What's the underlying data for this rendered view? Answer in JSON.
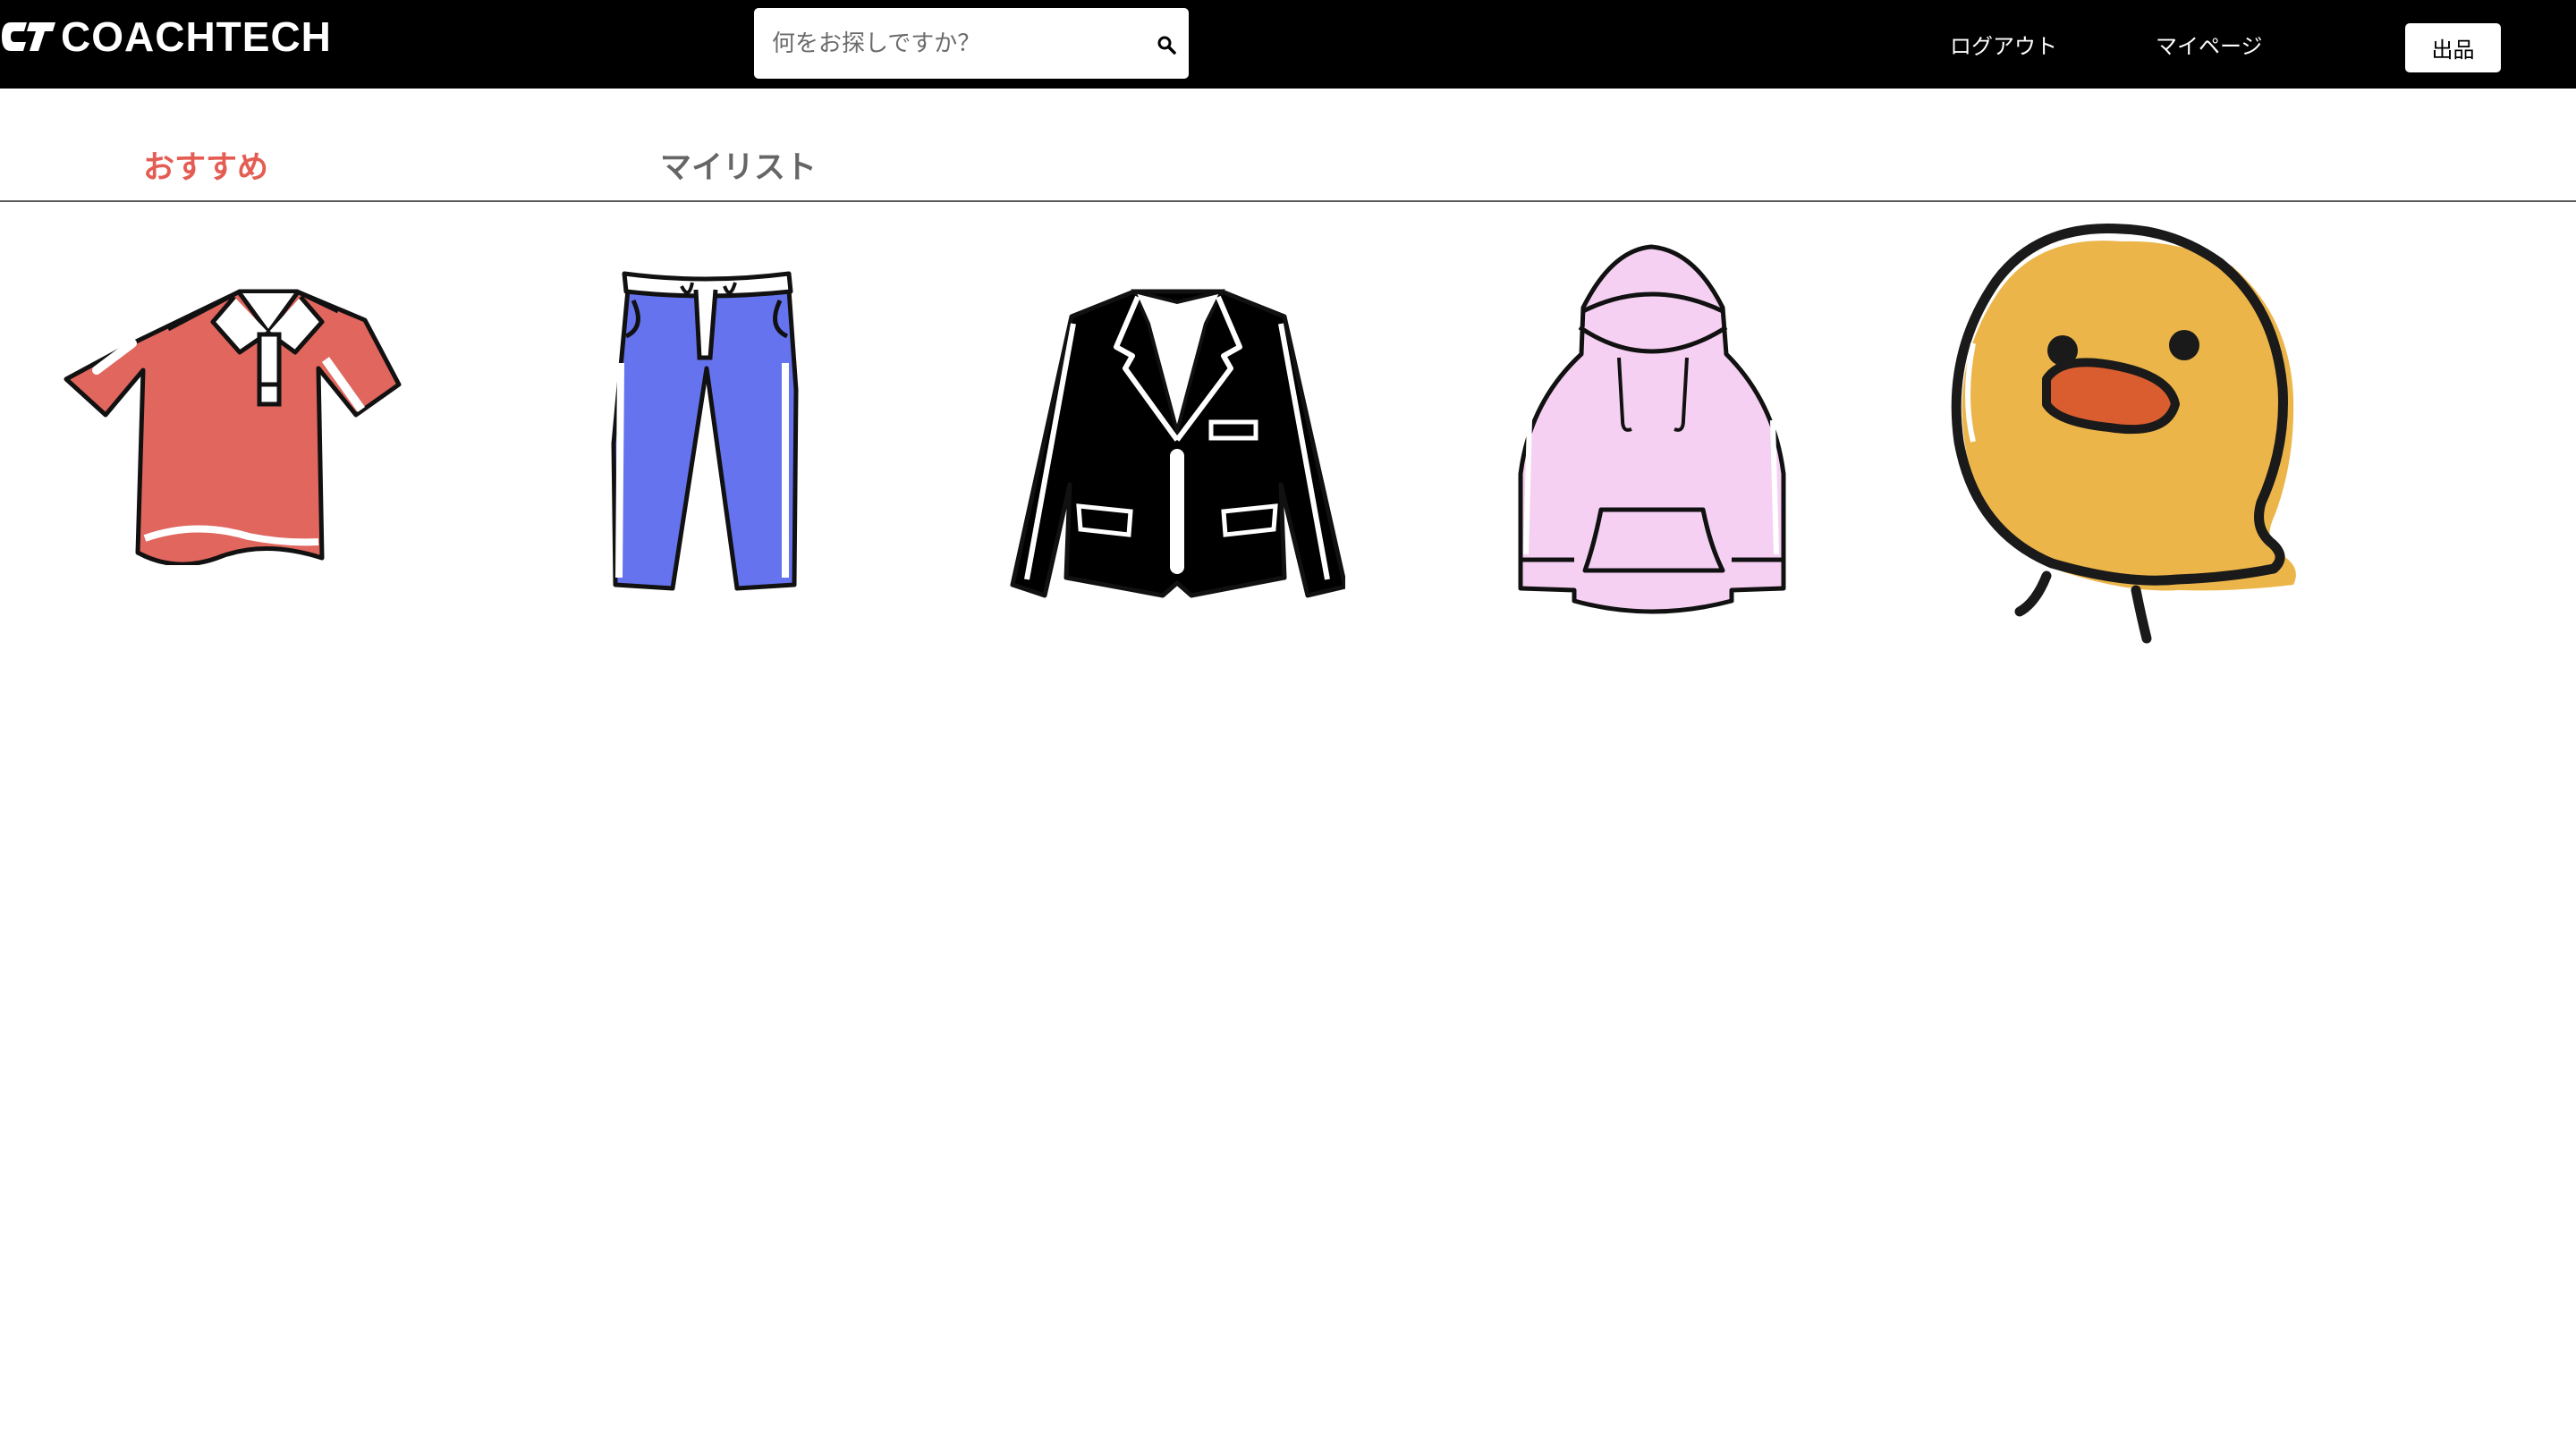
{
  "header": {
    "logo_text": "COACHTECH",
    "search_placeholder": "何をお探しですか？",
    "logout_label": "ログアウト",
    "mypage_label": "マイページ",
    "sell_label": "出品"
  },
  "tabs": [
    {
      "label": "おすすめ",
      "active": true
    },
    {
      "label": "マイリスト",
      "active": false
    }
  ],
  "items": [
    {
      "icon": "polo-shirt-icon",
      "color": "#e0665e"
    },
    {
      "icon": "pants-icon",
      "color": "#6673ee"
    },
    {
      "icon": "jacket-icon",
      "color": "#000000"
    },
    {
      "icon": "hoodie-icon",
      "color": "#f5d0f2"
    },
    {
      "icon": "chick-icon",
      "color": "#ecb54a"
    }
  ],
  "colors": {
    "header_bg": "#000000",
    "accent": "#e45c52",
    "tab_inactive": "#666666"
  }
}
